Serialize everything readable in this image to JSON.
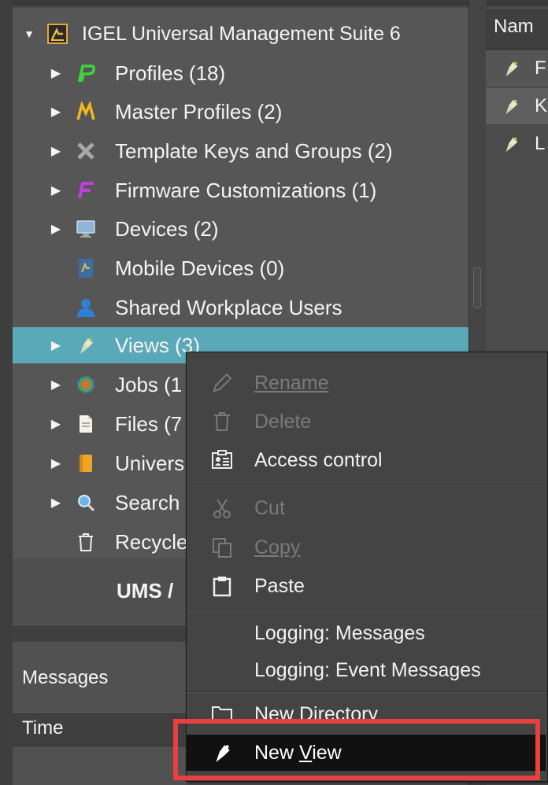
{
  "tree": {
    "root": {
      "label": "IGEL Universal Management Suite 6"
    },
    "items": [
      {
        "label": "Profiles (18)",
        "icon": "profiles-icon"
      },
      {
        "label": "Master Profiles (2)",
        "icon": "master-profiles-icon"
      },
      {
        "label": "Template Keys and Groups (2)",
        "icon": "template-keys-icon"
      },
      {
        "label": "Firmware Customizations (1)",
        "icon": "firmware-customizations-icon"
      },
      {
        "label": "Devices (2)",
        "icon": "devices-icon"
      },
      {
        "label": "Mobile Devices (0)",
        "icon": "mobile-devices-icon"
      },
      {
        "label": "Shared Workplace Users",
        "icon": "shared-workplace-users-icon"
      },
      {
        "label": "Views (3)",
        "icon": "views-icon",
        "selected": true
      },
      {
        "label": "Jobs (1",
        "icon": "jobs-icon"
      },
      {
        "label": "Files (7",
        "icon": "files-icon"
      },
      {
        "label": "Univers",
        "icon": "universal-icon"
      },
      {
        "label": "Search",
        "icon": "search-icon"
      },
      {
        "label": "Recycle",
        "icon": "recycle-bin-icon"
      }
    ],
    "footer_label": "UMS /"
  },
  "messages": {
    "title": "Messages",
    "column_time": "Time"
  },
  "right_panel": {
    "header": "Nam",
    "rows": [
      {
        "label": "F"
      },
      {
        "label": "K"
      },
      {
        "label": "L"
      }
    ]
  },
  "context_menu": {
    "rename": "Rename",
    "delete": "Delete",
    "access_control": "Access control",
    "cut": "Cut",
    "copy": "Copy",
    "paste": "Paste",
    "logging_messages": "Logging: Messages",
    "logging_event_messages": "Logging: Event Messages",
    "new_directory": "New Directory",
    "new_view_prefix": "New ",
    "new_view_mnemonic": "V",
    "new_view_suffix": "iew"
  },
  "colors": {
    "selection": "#5aa9b9",
    "highlight": "#e8403e",
    "panel": "#565656"
  }
}
